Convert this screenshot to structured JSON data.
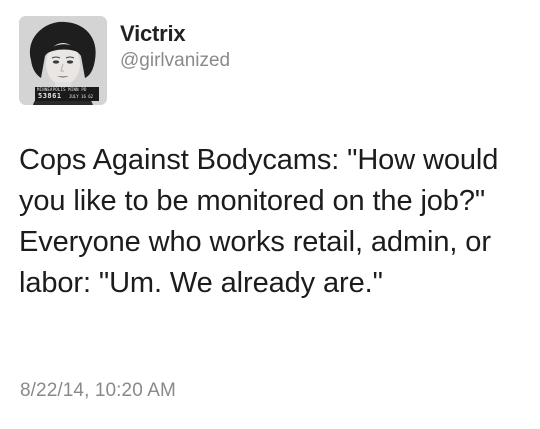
{
  "user": {
    "display_name": "Victrix",
    "handle": "@girlvanized",
    "avatar_board_top": "MINNEAPOLIS MINN PD",
    "avatar_board_number": "53861",
    "avatar_board_date": "JULY 16 62"
  },
  "tweet": {
    "text": "Cops Against Bodycams: \"How would you like to be monitored on the job?\" Everyone who works retail, admin, or labor: \"Um. We already are.\"",
    "timestamp": "8/22/14, 10:20 AM"
  }
}
